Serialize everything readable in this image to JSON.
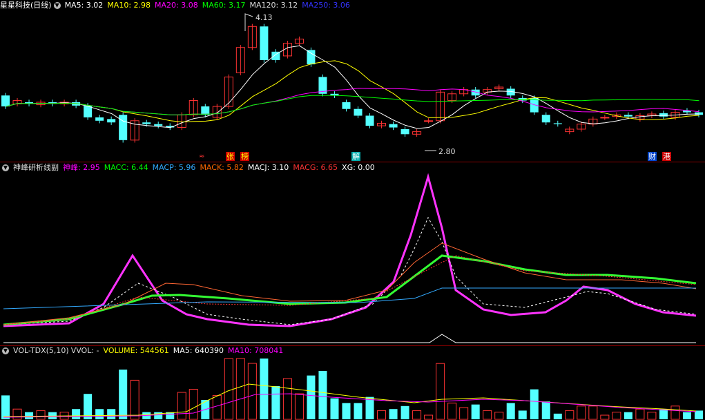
{
  "main": {
    "title": "星星科技(日线)",
    "indicators": [
      {
        "label": "MA5: 3.02",
        "color": "#ffffff"
      },
      {
        "label": "MA10: 2.98",
        "color": "#ffff00"
      },
      {
        "label": "MA20: 3.08",
        "color": "#ff00ff"
      },
      {
        "label": "MA60: 3.17",
        "color": "#00ff00"
      },
      {
        "label": "MA120: 3.12",
        "color": "#dddddd"
      },
      {
        "label": "MA250: 3.06",
        "color": "#3333ff"
      }
    ],
    "high_label": "4.13",
    "low_label": "2.80",
    "markers": [
      {
        "text": "张",
        "bg": "#cc0000",
        "fg": "#ffff00"
      },
      {
        "text": "榜",
        "bg": "#cc0000",
        "fg": "#ffff00"
      },
      {
        "text": "解",
        "bg": "#00aaaa",
        "fg": "#ffffff"
      },
      {
        "text": "财",
        "bg": "#0044cc",
        "fg": "#ffffff"
      },
      {
        "text": "港",
        "bg": "#cc0000",
        "fg": "#ffffff"
      }
    ],
    "candles": [
      {
        "o": 3.18,
        "c": 3.05
      },
      {
        "o": 3.08,
        "c": 3.12
      },
      {
        "o": 3.1,
        "c": 3.08
      },
      {
        "o": 3.07,
        "c": 3.1
      },
      {
        "o": 3.1,
        "c": 3.08
      },
      {
        "o": 3.08,
        "c": 3.1
      },
      {
        "o": 3.1,
        "c": 3.06
      },
      {
        "o": 3.06,
        "c": 2.92
      },
      {
        "o": 2.92,
        "c": 2.88
      },
      {
        "o": 2.9,
        "c": 2.86
      },
      {
        "o": 2.95,
        "c": 2.65
      },
      {
        "o": 2.65,
        "c": 2.88
      },
      {
        "o": 2.86,
        "c": 2.84
      },
      {
        "o": 2.84,
        "c": 2.82
      },
      {
        "o": 2.82,
        "c": 2.8
      },
      {
        "o": 2.8,
        "c": 2.95
      },
      {
        "o": 2.95,
        "c": 3.12
      },
      {
        "o": 3.05,
        "c": 2.95
      },
      {
        "o": 2.92,
        "c": 3.05
      },
      {
        "o": 3.05,
        "c": 3.4
      },
      {
        "o": 3.45,
        "c": 3.75
      },
      {
        "o": 3.75,
        "c": 4.0
      },
      {
        "o": 4.0,
        "c": 3.6
      },
      {
        "o": 3.7,
        "c": 3.6
      },
      {
        "o": 3.65,
        "c": 3.8
      },
      {
        "o": 3.8,
        "c": 3.85
      },
      {
        "o": 3.72,
        "c": 3.55
      },
      {
        "o": 3.4,
        "c": 3.2
      },
      {
        "o": 3.2,
        "c": 3.18
      },
      {
        "o": 3.1,
        "c": 3.02
      },
      {
        "o": 3.02,
        "c": 2.94
      },
      {
        "o": 2.94,
        "c": 2.82
      },
      {
        "o": 2.82,
        "c": 2.85
      },
      {
        "o": 2.84,
        "c": 2.8
      },
      {
        "o": 2.78,
        "c": 2.72
      },
      {
        "o": 2.72,
        "c": 2.75
      },
      {
        "o": 2.88,
        "c": 2.88
      },
      {
        "o": 2.88,
        "c": 3.22
      },
      {
        "o": 3.12,
        "c": 3.2
      },
      {
        "o": 3.2,
        "c": 3.25
      },
      {
        "o": 3.25,
        "c": 3.18
      },
      {
        "o": 3.22,
        "c": 3.25
      },
      {
        "o": 3.26,
        "c": 3.28
      },
      {
        "o": 3.26,
        "c": 3.18
      },
      {
        "o": 3.15,
        "c": 3.12
      },
      {
        "o": 3.15,
        "c": 2.98
      },
      {
        "o": 2.95,
        "c": 2.86
      },
      {
        "o": 2.85,
        "c": 2.84
      },
      {
        "o": 2.75,
        "c": 2.78
      },
      {
        "o": 2.78,
        "c": 2.84
      },
      {
        "o": 2.84,
        "c": 2.9
      },
      {
        "o": 2.92,
        "c": 2.92
      },
      {
        "o": 2.93,
        "c": 2.95
      },
      {
        "o": 2.95,
        "c": 2.93
      },
      {
        "o": 2.9,
        "c": 2.94
      },
      {
        "o": 2.94,
        "c": 2.96
      },
      {
        "o": 2.97,
        "c": 2.93
      },
      {
        "o": 2.92,
        "c": 2.98
      },
      {
        "o": 3.0,
        "c": 2.98
      },
      {
        "o": 2.98,
        "c": 2.95
      }
    ]
  },
  "sub": {
    "title": "神峰研析线副",
    "indicators": [
      {
        "label": "神峰: 2.95",
        "color": "#ff00ff"
      },
      {
        "label": "MACC: 6.44",
        "color": "#00ff00"
      },
      {
        "label": "MACP: 5.96",
        "color": "#33aaff"
      },
      {
        "label": "MACK: 5.82",
        "color": "#ff6600"
      },
      {
        "label": "MACJ: 3.10",
        "color": "#ffffff"
      },
      {
        "label": "MACG: 6.65",
        "color": "#ff3333"
      },
      {
        "label": "XG: 0.00",
        "color": "#ffffff"
      }
    ]
  },
  "vol": {
    "title": "VOL-TDX(5,10)",
    "indicators": [
      {
        "label": "VVOL: -",
        "color": "#dddddd"
      },
      {
        "label": "VOLUME: 544561",
        "color": "#ffff00"
      },
      {
        "label": "MA5: 640390",
        "color": "#ffffff"
      },
      {
        "label": "MA10: 708041",
        "color": "#ff00ff"
      }
    ]
  }
}
